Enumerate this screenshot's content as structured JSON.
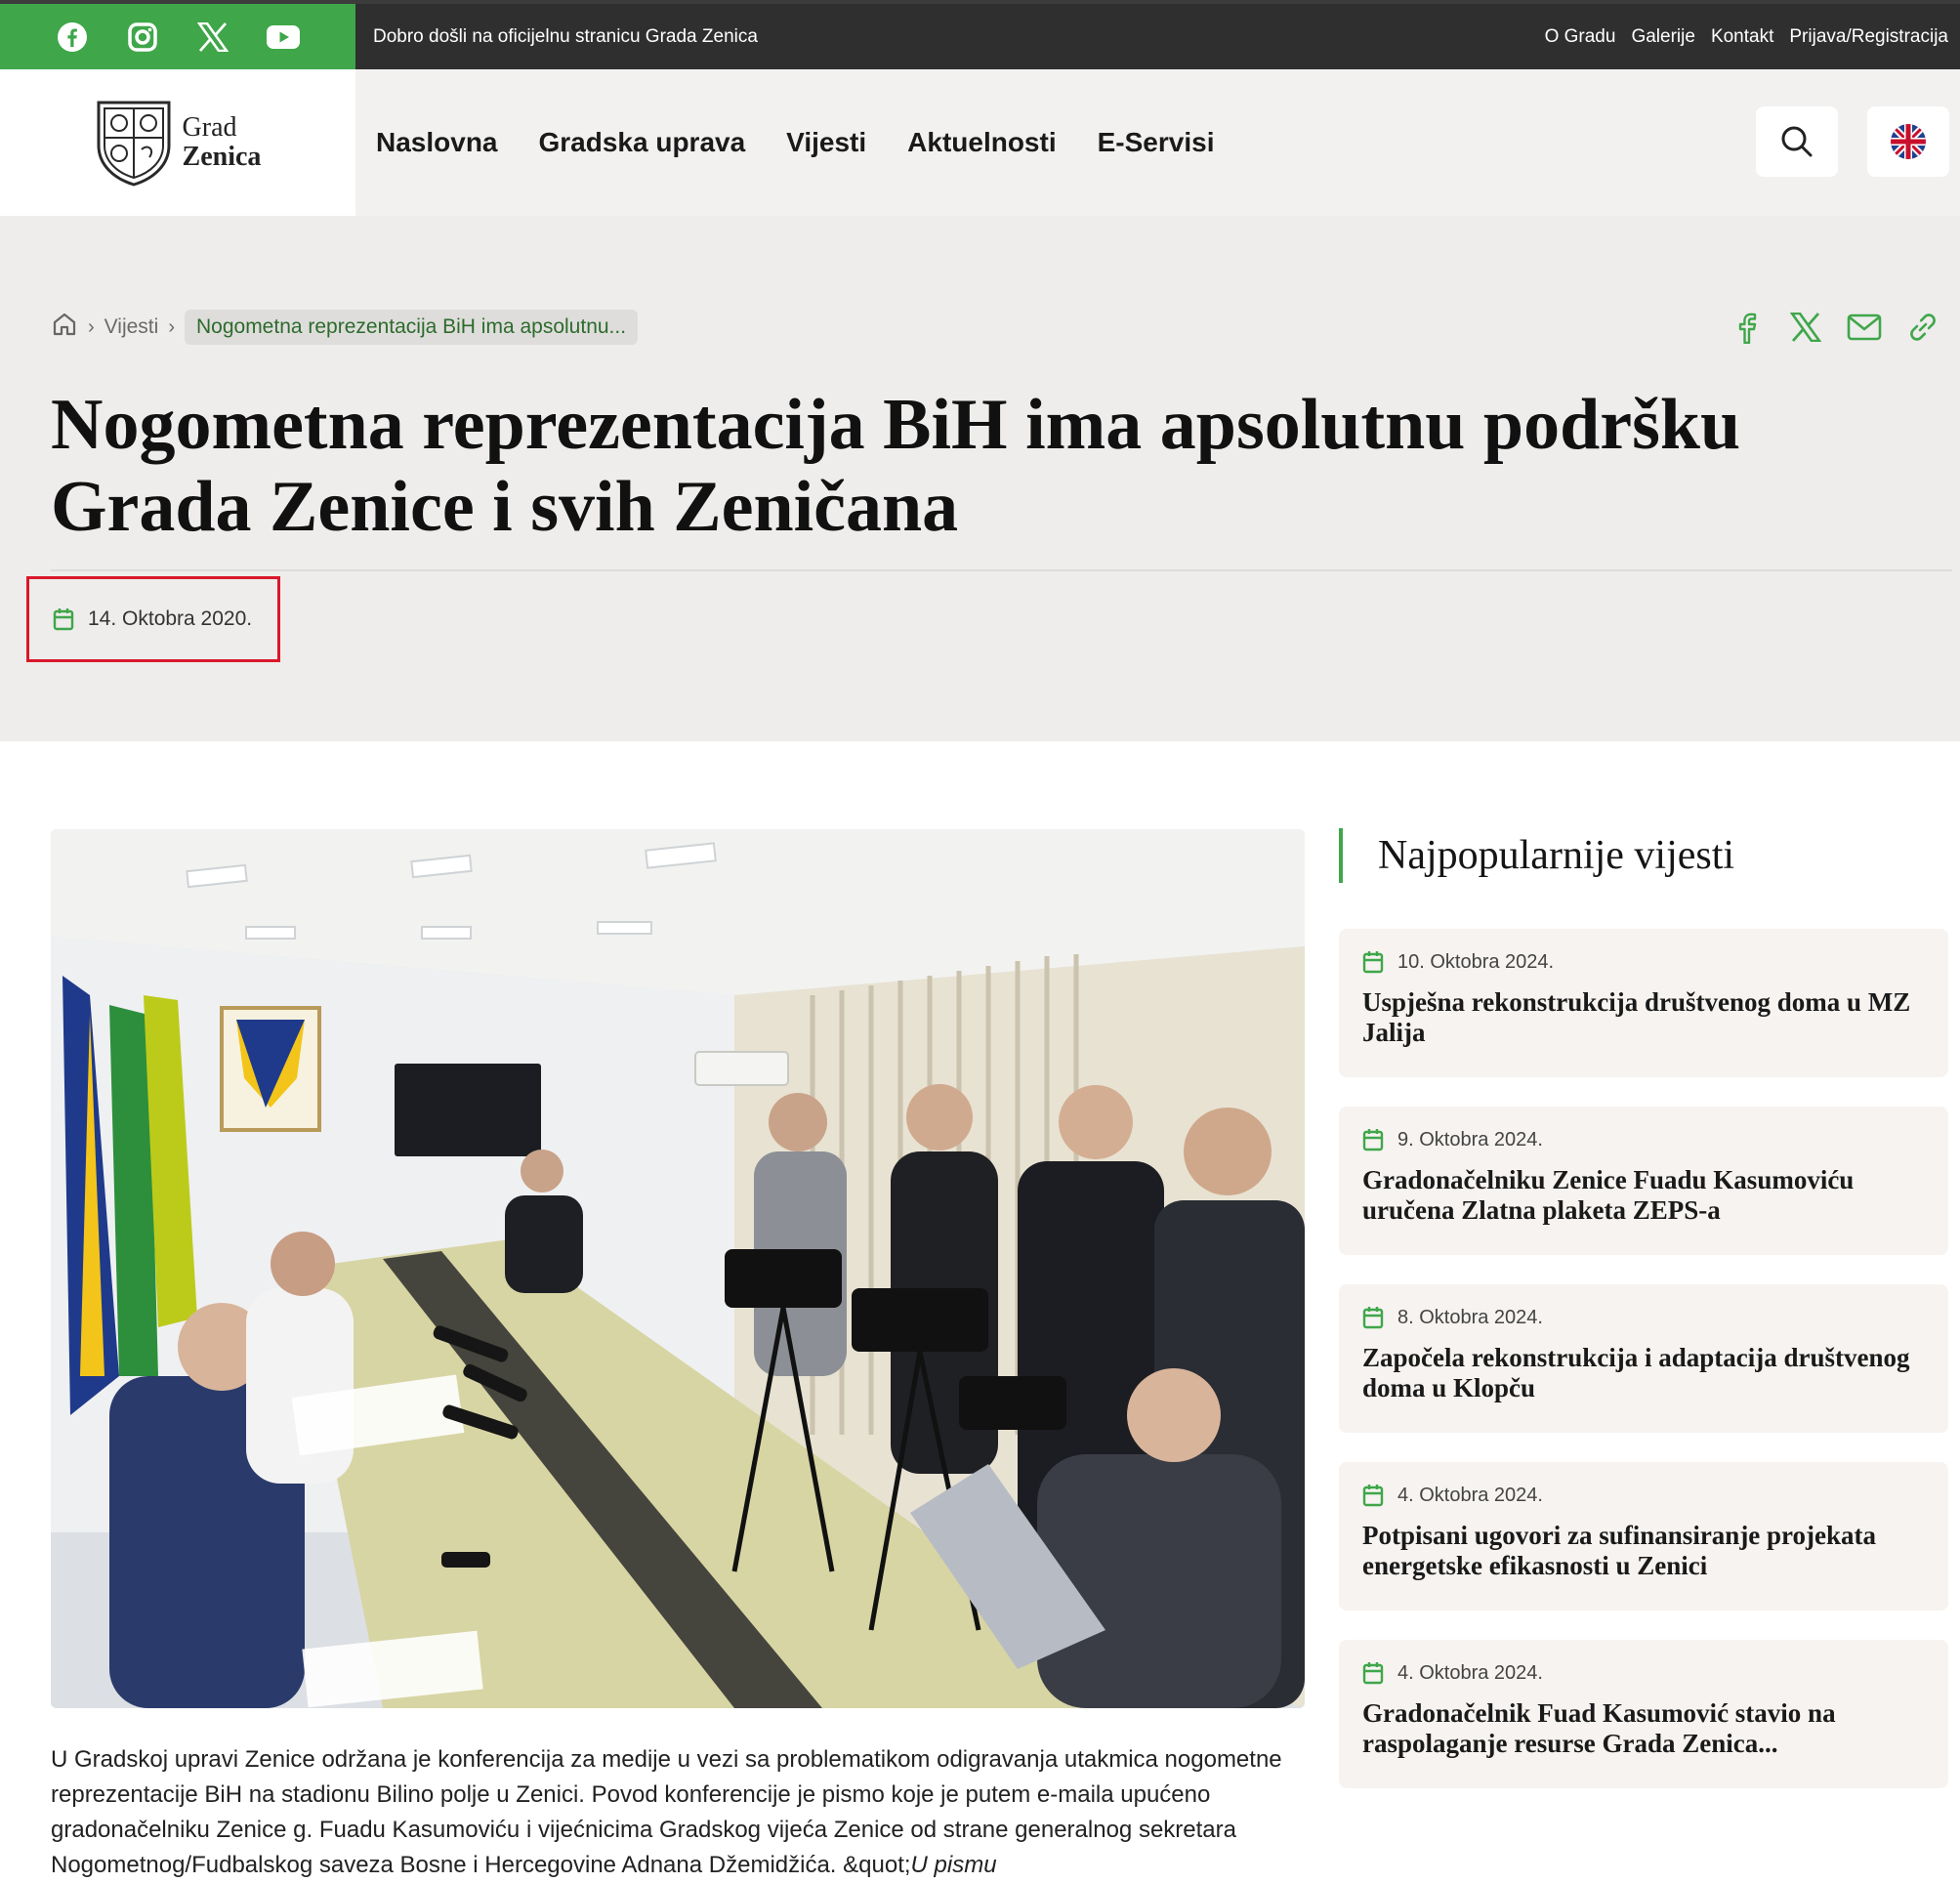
{
  "topbar": {
    "welcome": "Dobro došli na oficijelnu stranicu Grada Zenica",
    "links": [
      "O Gradu",
      "Galerije",
      "Kontakt",
      "Prijava/Registracija"
    ],
    "social_icons": [
      "facebook-icon",
      "instagram-icon",
      "x-icon",
      "youtube-icon"
    ]
  },
  "header": {
    "logo_line1": "Grad",
    "logo_line2": "Zenica",
    "nav": [
      "Naslovna",
      "Gradska uprava",
      "Vijesti",
      "Aktuelnosti",
      "E-Servisi"
    ]
  },
  "breadcrumb": {
    "section": "Vijesti",
    "current": "Nogometna reprezentacija BiH ima apsolutnu..."
  },
  "article": {
    "title": "Nogometna reprezentacija BiH ima apsolutnu podršku Grada Zenice i svih Zeničana",
    "date": "14. Oktobra 2020.",
    "body": "U Gradskoj upravi Zenice održana je konferencija za medije u vezi sa problematikom odigravanja utakmica nogometne reprezentacije BiH na stadionu Bilino polje u Zenici. Povod konferencije je pismo koje je putem e-maila upućeno gradonačelniku Zenice g. Fuadu Kasumoviću i vijećnicima Gradskog vijeća Zenice od strane generalnog sekretara Nogometnog/Fudbalskog saveza Bosne i Hercegovine Adnana Džemidžića. &quot;",
    "body_em": "U pismu"
  },
  "sidebar": {
    "heading": "Najpopularnije vijesti",
    "items": [
      {
        "date": "10. Oktobra 2024.",
        "title": "Uspješna rekonstrukcija društvenog doma u MZ Jalija"
      },
      {
        "date": "9. Oktobra 2024.",
        "title": "Gradonačelniku Zenice Fuadu Kasumoviću uručena Zlatna plaketa ZEPS-a"
      },
      {
        "date": "8. Oktobra 2024.",
        "title": "Započela rekonstrukcija i adaptacija društvenog doma u Klopču"
      },
      {
        "date": "4. Oktobra 2024.",
        "title": "Potpisani ugovori za sufinansiranje projekata energetske efikasnosti u Zenici"
      },
      {
        "date": "4. Oktobra 2024.",
        "title": "Gradonačelnik Fuad Kasumović stavio na raspolaganje resurse Grada Zenica..."
      }
    ]
  },
  "colors": {
    "brand_green": "#3fa64a",
    "topbar_dark": "#2f2f2f",
    "highlight_red": "#d9182b"
  }
}
